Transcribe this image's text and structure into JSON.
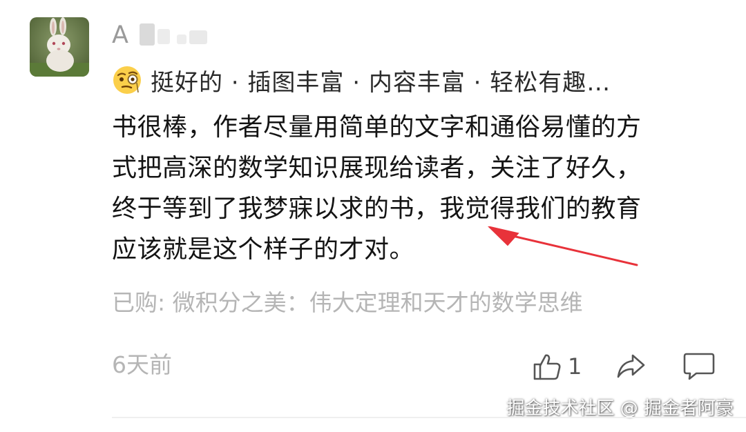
{
  "comment": {
    "username": "A",
    "tags": "挺好的 · 插图丰富 · 内容丰富 · 轻松有趣…",
    "review_lines": [
      "书很棒，作者尽量用简单的文字和通俗易懂的方",
      "式把高深的数学知识展现给读者，关注了好久，",
      "终于等到了我梦寐以求的书，我觉得我们的教育",
      "应该就是这个样子的才对。"
    ],
    "purchased": "已购: 微积分之美：伟大定理和天才的数学思维",
    "time": "6天前",
    "like_count": "1"
  },
  "watermark": "掘金技术社区 @ 掘金者阿豪",
  "icons": {
    "avatar": "rabbit-avatar",
    "emoji": "face-with-monocle-emoji",
    "like": "thumbs-up-icon",
    "share": "share-arrow-icon",
    "comment": "comment-bubble-icon",
    "annotation": "red-arrow"
  },
  "colors": {
    "arrow": "#e8323a",
    "muted_text": "#b5b5b5",
    "body_text": "#141414"
  }
}
